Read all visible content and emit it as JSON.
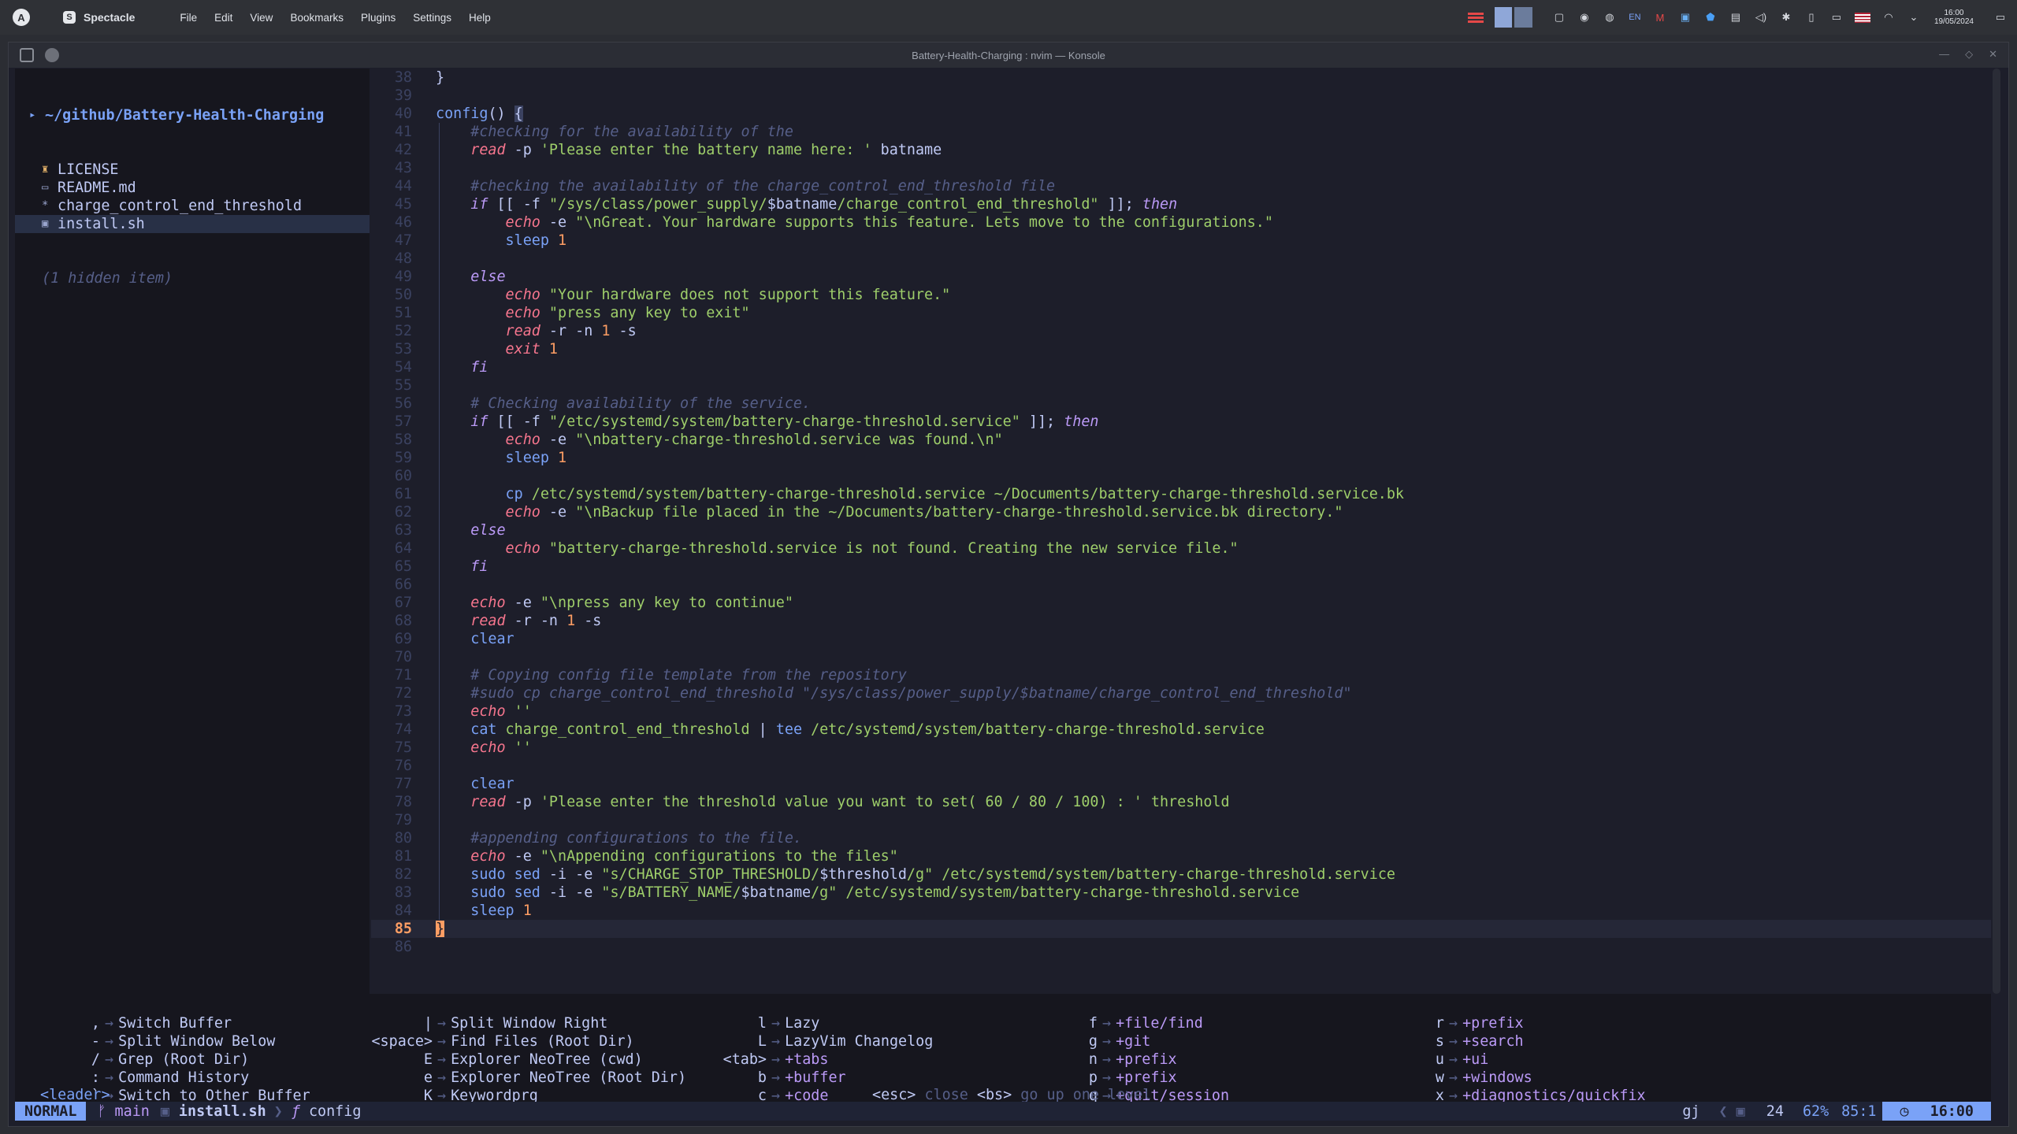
{
  "panel": {
    "app_name": "Spectacle",
    "menu": [
      "File",
      "Edit",
      "View",
      "Bookmarks",
      "Plugins",
      "Settings",
      "Help"
    ],
    "keyboard_layout": "EN",
    "clock_time": "16:00",
    "clock_date": "19/05/2024"
  },
  "window": {
    "title": "Battery-Health-Charging : nvim — Konsole"
  },
  "tree": {
    "root": "~/github/Battery-Health-Charging",
    "items": [
      {
        "icon": "license-icon",
        "glyph": "♜",
        "label": "LICENSE"
      },
      {
        "icon": "markdown-icon",
        "glyph": "▭",
        "label": "README.md"
      },
      {
        "icon": "config-file-icon",
        "glyph": "*",
        "label": "charge_control_end_threshold"
      },
      {
        "icon": "shell-file-icon",
        "glyph": "▣",
        "label": "install.sh"
      }
    ],
    "hidden": "(1 hidden item)"
  },
  "editor": {
    "current_line": 85,
    "lines": [
      {
        "n": "38",
        "indent": 0,
        "tokens": [
          [
            "p",
            "}"
          ]
        ]
      },
      {
        "n": "39",
        "indent": 0,
        "tokens": []
      },
      {
        "n": "40",
        "indent": 0,
        "tokens": [
          [
            "fn",
            "config"
          ],
          [
            "p",
            "() "
          ],
          [
            "br",
            "{"
          ]
        ]
      },
      {
        "n": "41",
        "indent": 1,
        "tokens": [
          [
            "c",
            "#checking for the availability of the"
          ]
        ]
      },
      {
        "n": "42",
        "indent": 1,
        "tokens": [
          [
            "b",
            "read"
          ],
          [
            "p",
            " -p "
          ],
          [
            "s",
            "'Please enter the battery name here: '"
          ],
          [
            "p",
            " batname"
          ]
        ]
      },
      {
        "n": "43",
        "indent": 0,
        "tokens": []
      },
      {
        "n": "44",
        "indent": 1,
        "tokens": [
          [
            "c",
            "#checking the availability of the charge_control_end_threshold file"
          ]
        ]
      },
      {
        "n": "45",
        "indent": 1,
        "tokens": [
          [
            "k",
            "if"
          ],
          [
            "p",
            " [[ -f "
          ],
          [
            "s",
            "\"/sys/class/power_supply/"
          ],
          [
            "v",
            "$batname"
          ],
          [
            "s",
            "/charge_control_end_threshold\""
          ],
          [
            "p",
            " ]]; "
          ],
          [
            "k",
            "then"
          ]
        ]
      },
      {
        "n": "46",
        "indent": 2,
        "tokens": [
          [
            "b",
            "echo"
          ],
          [
            "p",
            " -e "
          ],
          [
            "s",
            "\"\\nGreat. Your hardware supports this feature. Lets move to the configurations.\""
          ]
        ]
      },
      {
        "n": "47",
        "indent": 2,
        "tokens": [
          [
            "f",
            "sleep"
          ],
          [
            "p",
            " "
          ],
          [
            "n",
            "1"
          ]
        ]
      },
      {
        "n": "48",
        "indent": 0,
        "tokens": []
      },
      {
        "n": "49",
        "indent": 1,
        "tokens": [
          [
            "k",
            "else"
          ]
        ]
      },
      {
        "n": "50",
        "indent": 2,
        "tokens": [
          [
            "b",
            "echo"
          ],
          [
            "p",
            " "
          ],
          [
            "s",
            "\"Your hardware does not support this feature.\""
          ]
        ]
      },
      {
        "n": "51",
        "indent": 2,
        "tokens": [
          [
            "b",
            "echo"
          ],
          [
            "p",
            " "
          ],
          [
            "s",
            "\"press any key to exit\""
          ]
        ]
      },
      {
        "n": "52",
        "indent": 2,
        "tokens": [
          [
            "b",
            "read"
          ],
          [
            "p",
            " -r -n "
          ],
          [
            "n",
            "1"
          ],
          [
            "p",
            " -s"
          ]
        ]
      },
      {
        "n": "53",
        "indent": 2,
        "tokens": [
          [
            "b",
            "exit"
          ],
          [
            "p",
            " "
          ],
          [
            "n",
            "1"
          ]
        ]
      },
      {
        "n": "54",
        "indent": 1,
        "tokens": [
          [
            "k",
            "fi"
          ]
        ]
      },
      {
        "n": "55",
        "indent": 0,
        "tokens": []
      },
      {
        "n": "56",
        "indent": 1,
        "tokens": [
          [
            "c",
            "# Checking availability of the service."
          ]
        ]
      },
      {
        "n": "57",
        "indent": 1,
        "tokens": [
          [
            "k",
            "if"
          ],
          [
            "p",
            " [[ -f "
          ],
          [
            "s",
            "\"/etc/systemd/system/battery-charge-threshold.service\""
          ],
          [
            "p",
            " ]]; "
          ],
          [
            "k",
            "then"
          ]
        ]
      },
      {
        "n": "58",
        "indent": 2,
        "tokens": [
          [
            "b",
            "echo"
          ],
          [
            "p",
            " -e "
          ],
          [
            "s",
            "\"\\nbattery-charge-threshold.service was found.\\n\""
          ]
        ]
      },
      {
        "n": "59",
        "indent": 2,
        "tokens": [
          [
            "f",
            "sleep"
          ],
          [
            "p",
            " "
          ],
          [
            "n",
            "1"
          ]
        ]
      },
      {
        "n": "60",
        "indent": 0,
        "tokens": []
      },
      {
        "n": "61",
        "indent": 2,
        "tokens": [
          [
            "f",
            "cp"
          ],
          [
            "s",
            " /etc/systemd/system/battery-charge-threshold.service ~/Documents/battery-charge-threshold.service.bk"
          ]
        ]
      },
      {
        "n": "62",
        "indent": 2,
        "tokens": [
          [
            "b",
            "echo"
          ],
          [
            "p",
            " -e "
          ],
          [
            "s",
            "\"\\nBackup file placed in the ~/Documents/battery-charge-threshold.service.bk directory.\""
          ]
        ]
      },
      {
        "n": "63",
        "indent": 1,
        "tokens": [
          [
            "k",
            "else"
          ]
        ]
      },
      {
        "n": "64",
        "indent": 2,
        "tokens": [
          [
            "b",
            "echo"
          ],
          [
            "p",
            " "
          ],
          [
            "s",
            "\"battery-charge-threshold.service is not found. Creating the new service file.\""
          ]
        ]
      },
      {
        "n": "65",
        "indent": 1,
        "tokens": [
          [
            "k",
            "fi"
          ]
        ]
      },
      {
        "n": "66",
        "indent": 0,
        "tokens": []
      },
      {
        "n": "67",
        "indent": 1,
        "tokens": [
          [
            "b",
            "echo"
          ],
          [
            "p",
            " -e "
          ],
          [
            "s",
            "\"\\npress any key to continue\""
          ]
        ]
      },
      {
        "n": "68",
        "indent": 1,
        "tokens": [
          [
            "b",
            "read"
          ],
          [
            "p",
            " -r -n "
          ],
          [
            "n",
            "1"
          ],
          [
            "p",
            " -s"
          ]
        ]
      },
      {
        "n": "69",
        "indent": 1,
        "tokens": [
          [
            "f",
            "clear"
          ]
        ]
      },
      {
        "n": "70",
        "indent": 0,
        "tokens": []
      },
      {
        "n": "71",
        "indent": 1,
        "tokens": [
          [
            "c",
            "# Copying config file template from the repository"
          ]
        ]
      },
      {
        "n": "72",
        "indent": 1,
        "tokens": [
          [
            "c",
            "#sudo cp charge_control_end_threshold \"/sys/class/power_supply/$batname/charge_control_end_threshold\""
          ]
        ]
      },
      {
        "n": "73",
        "indent": 1,
        "tokens": [
          [
            "b",
            "echo"
          ],
          [
            "p",
            " "
          ],
          [
            "s",
            "''"
          ]
        ]
      },
      {
        "n": "74",
        "indent": 1,
        "tokens": [
          [
            "f",
            "cat"
          ],
          [
            "s",
            " charge_control_end_threshold "
          ],
          [
            "p",
            "| "
          ],
          [
            "f",
            "tee"
          ],
          [
            "s",
            " /etc/systemd/system/battery-charge-threshold.service"
          ]
        ]
      },
      {
        "n": "75",
        "indent": 1,
        "tokens": [
          [
            "b",
            "echo"
          ],
          [
            "p",
            " "
          ],
          [
            "s",
            "''"
          ]
        ]
      },
      {
        "n": "76",
        "indent": 0,
        "tokens": []
      },
      {
        "n": "77",
        "indent": 1,
        "tokens": [
          [
            "f",
            "clear"
          ]
        ]
      },
      {
        "n": "78",
        "indent": 1,
        "tokens": [
          [
            "b",
            "read"
          ],
          [
            "p",
            " -p "
          ],
          [
            "s",
            "'Please enter the threshold value you want to set( 60 / 80 / 100) : '"
          ],
          [
            "s",
            " threshold"
          ]
        ]
      },
      {
        "n": "79",
        "indent": 0,
        "tokens": []
      },
      {
        "n": "80",
        "indent": 1,
        "tokens": [
          [
            "c",
            "#appending configurations to the file."
          ]
        ]
      },
      {
        "n": "81",
        "indent": 1,
        "tokens": [
          [
            "b",
            "echo"
          ],
          [
            "p",
            " -e "
          ],
          [
            "s",
            "\"\\nAppending configurations to the files\""
          ]
        ]
      },
      {
        "n": "82",
        "indent": 1,
        "tokens": [
          [
            "f",
            "sudo"
          ],
          [
            "p",
            " "
          ],
          [
            "f",
            "sed"
          ],
          [
            "p",
            " -i -e "
          ],
          [
            "s",
            "\"s/CHARGE_STOP_THRESHOLD/"
          ],
          [
            "v",
            "$threshold"
          ],
          [
            "s",
            "/g\""
          ],
          [
            "s",
            " /etc/systemd/system/battery-charge-threshold.service"
          ]
        ]
      },
      {
        "n": "83",
        "indent": 1,
        "tokens": [
          [
            "f",
            "sudo"
          ],
          [
            "p",
            " "
          ],
          [
            "f",
            "sed"
          ],
          [
            "p",
            " -i -e "
          ],
          [
            "s",
            "\"s/BATTERY_NAME/"
          ],
          [
            "v",
            "$batname"
          ],
          [
            "s",
            "/g\""
          ],
          [
            "s",
            " /etc/systemd/system/battery-charge-threshold.service"
          ]
        ]
      },
      {
        "n": "84",
        "indent": 1,
        "tokens": [
          [
            "f",
            "sleep"
          ],
          [
            "p",
            " "
          ],
          [
            "n",
            "1"
          ]
        ]
      },
      {
        "n": "85",
        "indent": 0,
        "tokens": [
          [
            "cursor-char",
            "}"
          ]
        ]
      },
      {
        "n": "86",
        "indent": 0,
        "tokens": []
      }
    ]
  },
  "whichkey": {
    "columns": [
      [
        {
          "key": ",",
          "desc": "Switch Buffer",
          "grp": ""
        },
        {
          "key": "-",
          "desc": "Split Window Below",
          "grp": ""
        },
        {
          "key": "/",
          "desc": "Grep (Root Dir)",
          "grp": ""
        },
        {
          "key": ":",
          "desc": "Command History",
          "grp": ""
        },
        {
          "key": "`",
          "desc": "Switch to Other Buffer",
          "grp": ""
        }
      ],
      [
        {
          "key": "|",
          "desc": "Split Window Right",
          "grp": ""
        },
        {
          "key": "<space>",
          "desc": "Find Files (Root Dir)",
          "grp": ""
        },
        {
          "key": "E",
          "desc": "Explorer NeoTree (cwd)",
          "grp": ""
        },
        {
          "key": "e",
          "desc": "Explorer NeoTree (Root Dir)",
          "grp": ""
        },
        {
          "key": "K",
          "desc": "Keywordprg",
          "grp": ""
        }
      ],
      [
        {
          "key": "l",
          "desc": "Lazy",
          "grp": ""
        },
        {
          "key": "L",
          "desc": "LazyVim Changelog",
          "grp": ""
        },
        {
          "key": "<tab>",
          "desc": "+tabs",
          "grp": "grp"
        },
        {
          "key": "b",
          "desc": "+buffer",
          "grp": "grp"
        },
        {
          "key": "c",
          "desc": "+code",
          "grp": "grp"
        }
      ],
      [
        {
          "key": "f",
          "desc": "+file/find",
          "grp": "grp"
        },
        {
          "key": "g",
          "desc": "+git",
          "grp": "grp"
        },
        {
          "key": "n",
          "desc": "+prefix",
          "grp": "grp"
        },
        {
          "key": "p",
          "desc": "+prefix",
          "grp": "grp"
        },
        {
          "key": "q",
          "desc": "+quit/session",
          "grp": "grp"
        }
      ],
      [
        {
          "key": "r",
          "desc": "+prefix",
          "grp": "grp"
        },
        {
          "key": "s",
          "desc": "+search",
          "grp": "grp"
        },
        {
          "key": "u",
          "desc": "+ui",
          "grp": "grp"
        },
        {
          "key": "w",
          "desc": "+windows",
          "grp": "grp"
        },
        {
          "key": "x",
          "desc": "+diagnostics/quickfix",
          "grp": "grp"
        }
      ]
    ],
    "leader": "<leader>",
    "help_esc_key": "<esc>",
    "help_esc": "close",
    "help_bs_key": "<bs>",
    "help_bs": "go up one level"
  },
  "statusline": {
    "mode": "NORMAL",
    "branch": "main",
    "file": "install.sh",
    "symbol": "config",
    "pending_keys": "gj",
    "buffers": "24",
    "percent": "62%",
    "position": "85:1",
    "time": "16:00"
  },
  "colors": {
    "accent": "#7aa2f7",
    "background": "#1d1e2a",
    "keyword": "#bb9af7",
    "string": "#9ece6a",
    "builtin": "#f7768e",
    "comment": "#565f89"
  }
}
